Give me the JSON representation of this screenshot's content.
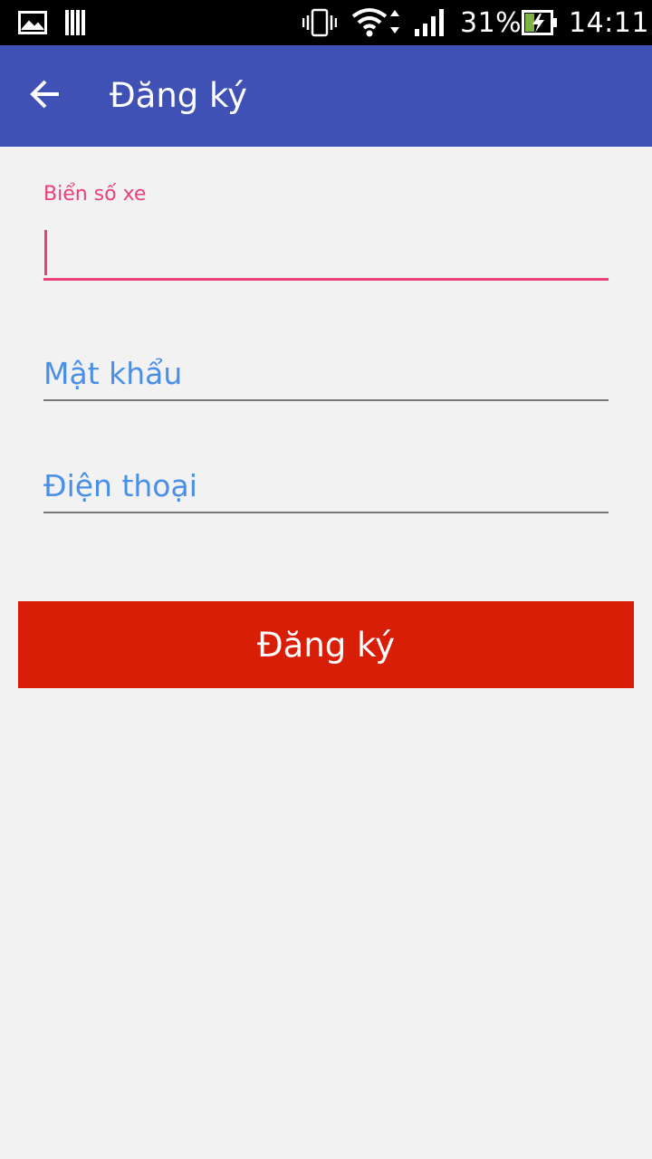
{
  "status_bar": {
    "battery_percent": "31%",
    "time": "14:11",
    "icons": [
      "image-icon",
      "storage-icon",
      "vibrate-icon",
      "wifi-icon",
      "signal-icon",
      "battery-charging-icon"
    ]
  },
  "app_bar": {
    "title": "Đăng ký",
    "back_icon": "arrow-back-icon",
    "background": "#3f51b5"
  },
  "form": {
    "plate": {
      "label": "Biển số xe",
      "value": "",
      "active": true
    },
    "password": {
      "placeholder": "Mật khẩu",
      "value": ""
    },
    "phone": {
      "placeholder": "Điện thoại",
      "value": ""
    },
    "submit_label": "Đăng ký"
  },
  "colors": {
    "accent": "#ec407a",
    "hint": "#4a8fe7",
    "button": "#d81e06",
    "background": "#f2f2f2"
  }
}
